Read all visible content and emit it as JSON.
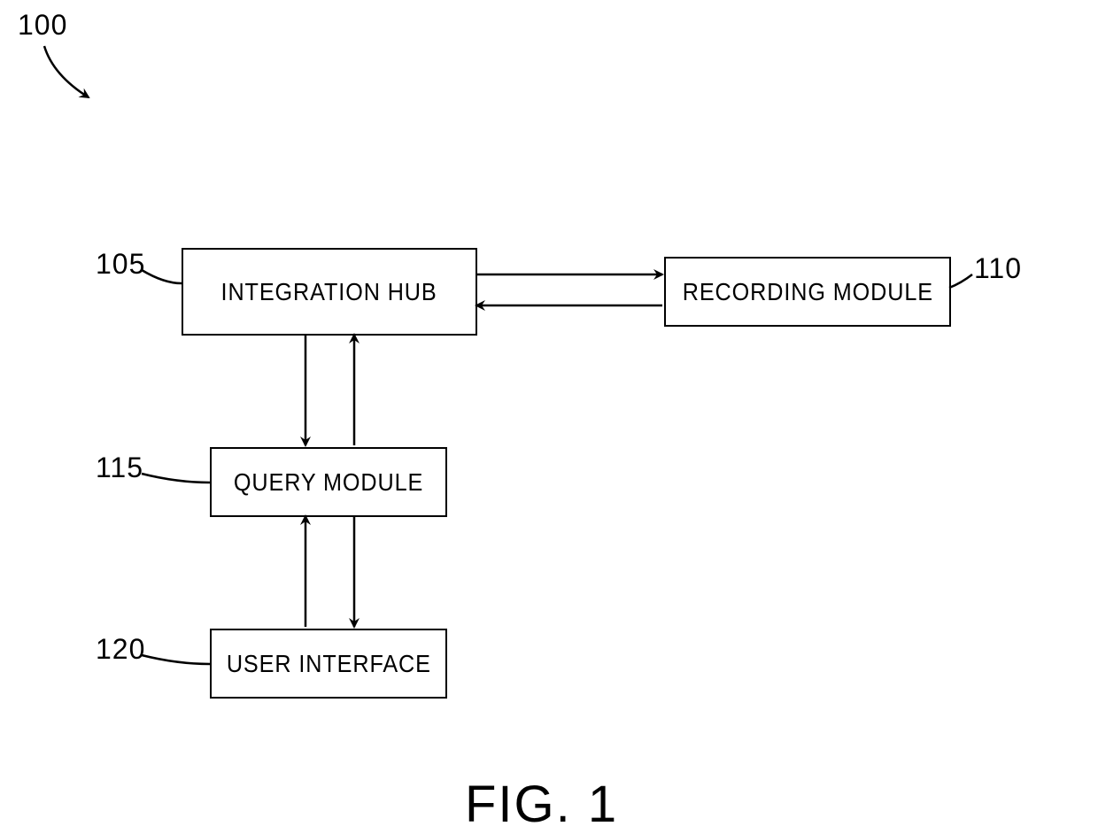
{
  "figure": {
    "number_label": "100",
    "caption": "FIG. 1"
  },
  "blocks": {
    "integration_hub": {
      "ref": "105",
      "label": "INTEGRATION HUB"
    },
    "recording_module": {
      "ref": "110",
      "label": "RECORDING MODULE"
    },
    "query_module": {
      "ref": "115",
      "label": "QUERY MODULE"
    },
    "user_interface": {
      "ref": "120",
      "label": "USER INTERFACE"
    }
  }
}
